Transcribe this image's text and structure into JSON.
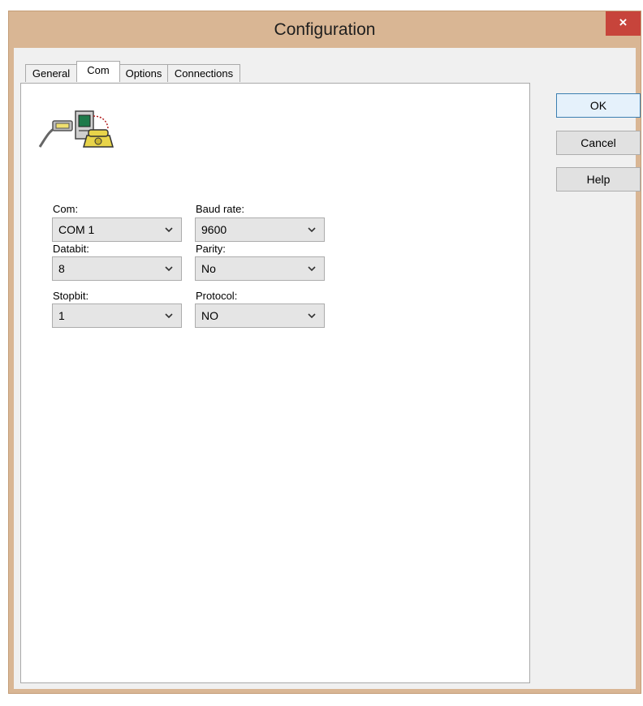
{
  "window": {
    "title": "Configuration",
    "close_label": "×"
  },
  "tabs": [
    {
      "label": "General"
    },
    {
      "label": "Com"
    },
    {
      "label": "Options"
    },
    {
      "label": "Connections"
    }
  ],
  "buttons": {
    "ok": "OK",
    "cancel": "Cancel",
    "help": "Help"
  },
  "com": {
    "port": {
      "label": "Com:",
      "value": "COM 1"
    },
    "baud": {
      "label": "Baud rate:",
      "value": "9600"
    },
    "databit": {
      "label": "Databit:",
      "value": "8"
    },
    "parity": {
      "label": "Parity:",
      "value": "No"
    },
    "stopbit": {
      "label": "Stopbit:",
      "value": "1"
    },
    "protocol": {
      "label": "Protocol:",
      "value": "NO"
    }
  },
  "icons": {
    "header": "serial-connection-computer-phone-icon",
    "close": "close-icon",
    "dropdown": "chevron-down-icon"
  },
  "colors": {
    "titlebar": "#d9b694",
    "close": "#c7443b",
    "default_button_border": "#3c7fb1"
  }
}
